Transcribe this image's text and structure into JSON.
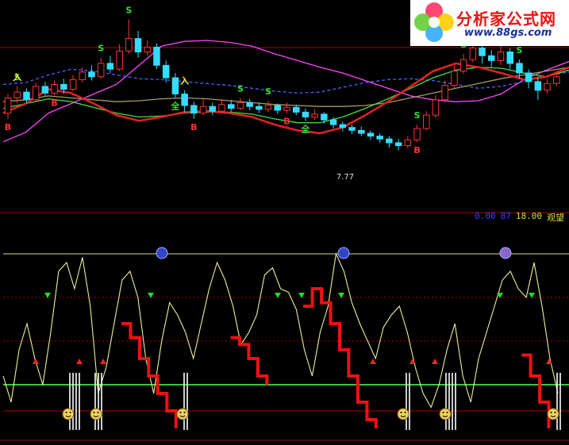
{
  "watermark": {
    "title": "分析家公式网",
    "url": "www.88gs.com",
    "colors": {
      "title": "#ee1111",
      "url": "#1a2f99",
      "flower": [
        "#ff3366",
        "#ffcc00",
        "#33aaff",
        "#66cc33"
      ]
    }
  },
  "indicator_legend": {
    "name": "观望",
    "value_1": "18.00",
    "value_2": "87",
    "value_3": "0.00"
  },
  "price_panel": {
    "signals": {
      "buy": "B",
      "sell": "S",
      "enter": "入",
      "full": "全"
    },
    "low_label": "7.77"
  },
  "colors": {
    "background": "#000000",
    "grid_red": "#aa0000",
    "up_candle": "#ff3333",
    "down_candle": "#33ddff",
    "ma_magenta": "#ff44ff",
    "ma_blue_dashed": "#4466ff",
    "ma_olive": "#aa9966",
    "ma_green": "#44dd44",
    "ma_red_thick": "#dd2222",
    "osc_yellow": "#eeee99",
    "osc_red": "#ee1111",
    "baseline_green": "#33cc33"
  },
  "chart_data": [
    {
      "type": "line",
      "panel": "price",
      "xlabel": "",
      "ylabel": "",
      "grid": false,
      "series": [
        {
          "values": [
            3,
            4,
            6,
            7,
            8,
            9,
            11,
            13,
            13.5,
            13.6,
            13.4,
            13,
            12.2,
            11.5,
            10.8,
            10.2,
            9.4,
            8.6,
            7.8,
            7.4,
            7.2,
            7.3,
            8,
            9.5,
            10.5,
            11.4
          ]
        },
        {
          "values": [
            9,
            9.2,
            10,
            10.6,
            10.4,
            10,
            9.6,
            9.5,
            9.3,
            9.1,
            8.9,
            8.6,
            8.3,
            8.1,
            8.2,
            8.7,
            9.2,
            9.5,
            9.6,
            9.4,
            9,
            8.6,
            8.8,
            9.3,
            9.9,
            10.3
          ]
        },
        {
          "values": [
            7.2,
            7.4,
            7.8,
            7.6,
            7.4,
            7.2,
            7.3,
            7.5,
            7.6,
            7.5,
            7.3,
            7.1,
            6.9,
            6.8,
            6.7,
            6.7,
            6.8,
            7.1,
            7.6,
            8.1,
            8.6,
            9.1,
            9.6,
            10,
            10.4,
            10.8
          ]
        },
        {
          "values": [
            6.5,
            7,
            7.5,
            7.2,
            6.6,
            6,
            5.6,
            5.7,
            6,
            6.1,
            6.1,
            5.9,
            5.4,
            5,
            5,
            5.6,
            6.5,
            7.5,
            8.6,
            9.7,
            10.5,
            10.8,
            10.7,
            10.2,
            9.8,
            10.5
          ]
        },
        {
          "values": [
            6,
            7,
            8.5,
            8.1,
            7,
            5.8,
            5.2,
            5.6,
            6.1,
            6.2,
            6,
            5.6,
            4.8,
            4.2,
            3.9,
            4.5,
            5.8,
            7.2,
            8.8,
            10.4,
            11.2,
            10.8,
            10.2,
            9.5,
            9.8,
            10.8
          ]
        }
      ],
      "candles": [
        [
          6,
          7.6,
          5.4,
          8
        ],
        [
          7.6,
          8.2,
          7,
          8.8
        ],
        [
          8.2,
          7.4,
          7,
          8.6
        ],
        [
          7.4,
          8.8,
          7.2,
          9.2
        ],
        [
          8.8,
          8.1,
          7.8,
          9.3
        ],
        [
          8.1,
          9,
          7.9,
          9.4
        ],
        [
          9,
          8.5,
          8,
          9.6
        ],
        [
          8.5,
          9.5,
          8.3,
          10
        ],
        [
          9.5,
          10.3,
          9.2,
          10.8
        ],
        [
          10.3,
          9.8,
          9.4,
          11
        ],
        [
          9.8,
          11.2,
          9.6,
          11.8
        ],
        [
          11.2,
          10.6,
          10.2,
          12
        ],
        [
          10.6,
          12.5,
          10.4,
          13.2
        ],
        [
          12.5,
          13.8,
          12.2,
          15.8
        ],
        [
          13.8,
          12.4,
          11.8,
          14.6
        ],
        [
          12.4,
          12.9,
          12,
          13.6
        ],
        [
          12.9,
          11,
          10.6,
          13.3
        ],
        [
          11,
          9.7,
          9.2,
          11.5
        ],
        [
          9.7,
          8,
          7.6,
          10.2
        ],
        [
          8,
          6.8,
          6.1,
          8.4
        ],
        [
          6.8,
          6,
          5.4,
          7.2
        ],
        [
          6,
          6.7,
          5.8,
          7.4
        ],
        [
          6.7,
          6.2,
          5.8,
          7.1
        ],
        [
          6.2,
          6.9,
          6,
          7.5
        ],
        [
          6.9,
          6.5,
          6.1,
          7.4
        ],
        [
          6.5,
          7.1,
          6.3,
          7.6
        ],
        [
          7.1,
          6.7,
          6.3,
          7.5
        ],
        [
          6.7,
          6.4,
          6,
          7.1
        ],
        [
          6.4,
          6.8,
          6.1,
          7.3
        ],
        [
          6.8,
          6.3,
          5.9,
          7
        ],
        [
          6.3,
          6.6,
          6,
          7.1
        ],
        [
          6.6,
          6.1,
          5.8,
          6.9
        ],
        [
          6.1,
          5.6,
          5.2,
          6.5
        ],
        [
          5.6,
          5.9,
          5.3,
          6.4
        ],
        [
          5.9,
          5.3,
          4.9,
          6.1
        ],
        [
          5.3,
          4.8,
          4.4,
          5.6
        ],
        [
          4.8,
          4.5,
          4.1,
          5.1
        ],
        [
          4.5,
          4.2,
          3.8,
          4.8
        ],
        [
          4.2,
          3.9,
          3.6,
          4.6
        ],
        [
          3.9,
          3.6,
          3.2,
          4.2
        ],
        [
          3.6,
          3.3,
          2.9,
          3.9
        ],
        [
          3.3,
          2.9,
          2.4,
          3.6
        ],
        [
          2.9,
          2.6,
          2.1,
          3.3
        ],
        [
          2.6,
          3.2,
          2.3,
          3.6
        ],
        [
          3.2,
          4.4,
          3,
          4.8
        ],
        [
          4.4,
          5.8,
          4.2,
          6.2
        ],
        [
          5.8,
          7.4,
          5.5,
          7.9
        ],
        [
          7.4,
          8.9,
          7.1,
          9.4
        ],
        [
          8.9,
          10.4,
          8.6,
          11
        ],
        [
          10.4,
          11.6,
          10.1,
          12.2
        ],
        [
          11.6,
          12.8,
          11.3,
          14.6
        ],
        [
          12.8,
          12,
          11.2,
          13.6
        ],
        [
          12,
          11.5,
          10.8,
          12.6
        ],
        [
          11.5,
          12.4,
          11,
          13
        ],
        [
          12.4,
          11.2,
          10.6,
          12.8
        ],
        [
          11.2,
          10.2,
          9.6,
          11.6
        ],
        [
          10.2,
          9.3,
          8.6,
          10.6
        ],
        [
          9.3,
          8.4,
          7.4,
          9.8
        ],
        [
          8.4,
          9.1,
          8,
          9.6
        ],
        [
          9.1,
          9.8,
          8.8,
          10.4
        ]
      ],
      "ylim": [
        0,
        17
      ]
    },
    {
      "type": "line",
      "panel": "oscillator",
      "xlabel": "",
      "ylabel": "",
      "grid": true,
      "ylim": [
        0,
        100
      ],
      "reference_lines": [
        100,
        75,
        50,
        25,
        10
      ],
      "series": [
        {
          "values": [
            30,
            15,
            45,
            60,
            40,
            25,
            55,
            90,
            95,
            80,
            98,
            70,
            20,
            35,
            60,
            85,
            90,
            75,
            40,
            20,
            50,
            72,
            65,
            55,
            40,
            60,
            80,
            95,
            85,
            70,
            48,
            55,
            65,
            88,
            92,
            80,
            78,
            68,
            45,
            30,
            55,
            70,
            100,
            90,
            72,
            60,
            50,
            40,
            58,
            65,
            70,
            55,
            35,
            20,
            12,
            25,
            45,
            60,
            30,
            15,
            40,
            55,
            70,
            85,
            90,
            80,
            75,
            95,
            70,
            40,
            20
          ]
        },
        {
          "values": [
            null,
            null,
            null,
            null,
            null,
            null,
            null,
            null,
            null,
            null,
            null,
            null,
            null,
            60,
            52,
            40,
            30,
            20,
            10,
            0,
            null,
            null,
            null,
            null,
            null,
            52,
            48,
            40,
            30,
            25,
            null,
            null,
            null,
            70,
            80,
            72,
            60,
            45,
            30,
            15,
            5,
            0,
            null,
            null,
            null,
            null,
            null,
            null,
            null,
            null,
            null,
            null,
            null,
            null,
            null,
            null,
            null,
            42,
            30,
            15,
            0,
            null
          ]
        }
      ]
    }
  ]
}
